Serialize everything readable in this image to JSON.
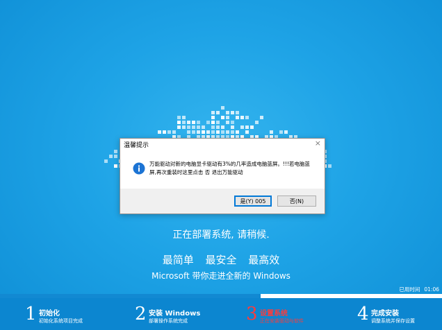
{
  "dialog": {
    "title": "温馨提示",
    "close_glyph": "×",
    "message": "万能驱动对新的电脑显卡驱动有3%的几率造成电脑蓝屏。!!!若电脑蓝屏,再次重装时这里点击 否 退出万能驱动",
    "yes_label": "是(Y) 005",
    "no_label": "否(N)"
  },
  "status_text": "正在部署系统, 请稍候.",
  "slogan": [
    "最简单",
    "最安全",
    "最高效"
  ],
  "tagline": "Microsoft 带你走进全新的 Windows",
  "elapsed": {
    "label": "已用时间",
    "value": "01:06"
  },
  "progress": 0.59,
  "steps": [
    {
      "num": "1",
      "title": "初始化",
      "sub": "初始化系统项目完成",
      "active": false
    },
    {
      "num": "2",
      "title": "安装 Windows",
      "sub": "部署操作系统完成",
      "active": false
    },
    {
      "num": "3",
      "title": "设置系统",
      "sub": "正在安装驱动与软件",
      "active": true
    },
    {
      "num": "4",
      "title": "完成安装",
      "sub": "调整系统并保存设置",
      "active": false
    }
  ],
  "colors": {
    "background": "#1ea3e6",
    "active_step": "#ff3b3b",
    "progress_fill": "#1289d2"
  },
  "icons": {
    "dialog": "info-icon"
  }
}
